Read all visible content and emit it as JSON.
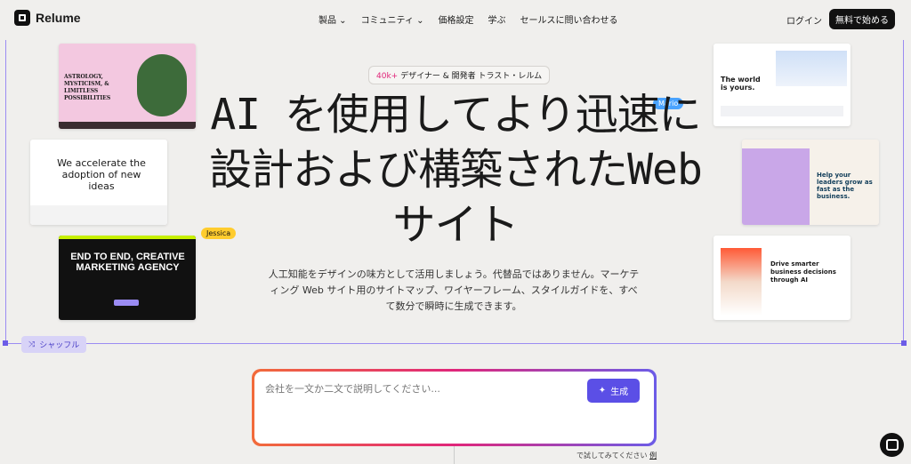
{
  "nav": {
    "brand": "Relume",
    "items": [
      "製品",
      "コミュニティ",
      "価格設定",
      "学ぶ",
      "セールスに問い合わせる"
    ],
    "login": "ログイン",
    "cta": "無料で始める"
  },
  "badge": {
    "count": "40k+",
    "text": " デザイナー & 開発者 トラスト・レルム"
  },
  "hero": {
    "title": "AI を使用してより迅速に設計および構築されたWeb サイト",
    "subtitle": "人工知能をデザインの味方として活用しましょう。代替品ではありません。マーケティング Web サイト用のサイトマップ、ワイヤーフレーム、スタイルガイドを、すべて数分で瞬時に生成できます。"
  },
  "cursors": {
    "mario": "Mario",
    "jessica": "Jessica"
  },
  "shuffle": "シャッフル",
  "prompt": {
    "placeholder": "会社を一文か二文で説明してください...",
    "button": "生成"
  },
  "try": {
    "text": "で試してみてください",
    "link": "例"
  },
  "cards": {
    "astro": {
      "headline": "ASTROLOGY, MYSTICISM, & LIMITLESS POSSIBILITIES"
    },
    "accel": {
      "headline": "We accelerate the adoption of new ideas"
    },
    "agency": {
      "headline": "END TO END, CREATIVE MARKETING AGENCY"
    },
    "world": {
      "headline": "The world is yours."
    },
    "leaders": {
      "headline": "Help your leaders grow as fast as the business."
    },
    "drive": {
      "headline": "Drive smarter business decisions through AI"
    }
  }
}
